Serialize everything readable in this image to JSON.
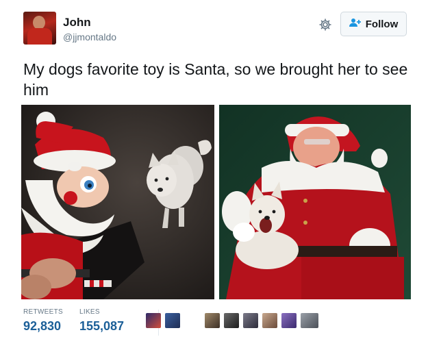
{
  "header": {
    "name": "John",
    "handle": "@jjmontaldo",
    "follow_label": "Follow",
    "gear_icon": "gear-icon",
    "follow_icon": "add-user-icon"
  },
  "tweet": {
    "text": "My dogs favorite toy is Santa, so we brought her to see him"
  },
  "stats": {
    "retweets_label": "RETWEETS",
    "retweets_value": "92,830",
    "likes_label": "LIKES",
    "likes_value": "155,087"
  },
  "colors": {
    "accent": "#1b95e0",
    "stat_value": "#1b5f98",
    "muted": "#657786",
    "text": "#14171a"
  }
}
